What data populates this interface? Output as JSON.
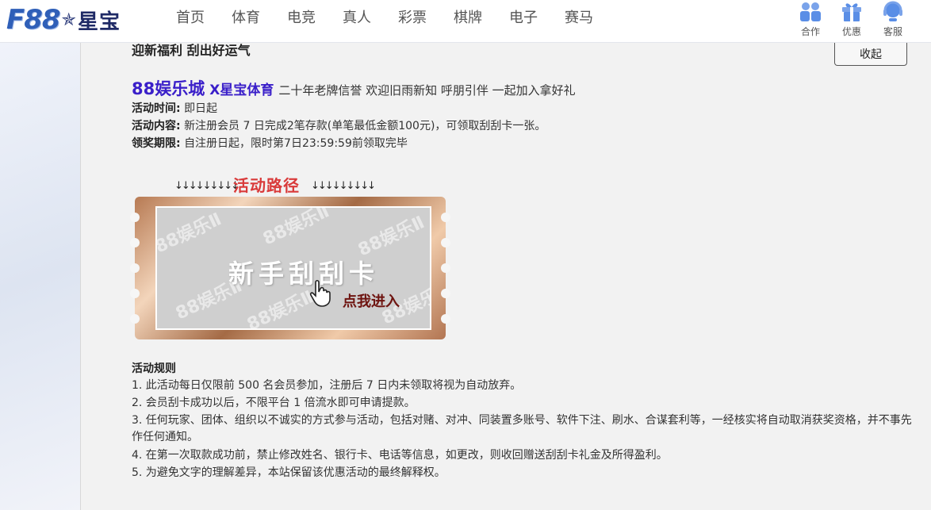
{
  "header": {
    "logo_main": "F88",
    "logo_star": "✯",
    "logo_brand": "星宝",
    "nav": [
      "首页",
      "体育",
      "电竞",
      "真人",
      "彩票",
      "棋牌",
      "电子",
      "赛马"
    ],
    "right": [
      {
        "label": "合作",
        "icon": "partner-icon"
      },
      {
        "label": "优惠",
        "icon": "gift-icon"
      },
      {
        "label": "客服",
        "icon": "support-icon"
      }
    ]
  },
  "page": {
    "title": "迎新福利 刮出好运气",
    "collapse_label": "收起",
    "headline_main": "88娱乐城",
    "headline_sub": "X星宝体育",
    "headline_desc": "二十年老牌信誉 欢迎旧雨新知 呼朋引伴 一起加入拿好礼",
    "time_label": "活动时间:",
    "time_value": "即日起",
    "content_label": "活动内容:",
    "content_value": "新注册会员 7 日完成2笔存款(单笔最低金额100元)，可领取刮刮卡一张。",
    "deadline_label": "领奖期限:",
    "deadline_value": "自注册日起，限时第7日23:59:59前领取完毕",
    "path_label": "活动路径",
    "arrows": "↓↓↓↓↓↓↓↓↓",
    "card_title": "新手刮刮卡",
    "card_enter": "点我进入",
    "card_watermark": "88娱乐Ⅱ",
    "rules_title": "活动规则",
    "rules": [
      "1. 此活动每日仅限前 500 名会员参加，注册后 7 日内未领取将视为自动放弃。",
      "2. 会员刮卡成功以后，不限平台 1 倍流水即可申请提款。",
      "3. 任何玩家、团体、组织以不诚实的方式参与活动，包括对赌、对冲、同装置多账号、软件下注、刷水、合谋套利等，一经核实将自动取消获奖资格，并不事先作任何通知。",
      "4. 在第一次取款成功前，禁止修改姓名、银行卡、电话等信息，如更改，则收回赠送刮刮卡礼金及所得盈利。",
      "5. 为避免文字的理解差异，本站保留该优惠活动的最终解释权。"
    ]
  },
  "colors": {
    "headline": "#3a1fc9",
    "path_label": "#d93a3a",
    "accent_blue": "#5a8ee6"
  }
}
